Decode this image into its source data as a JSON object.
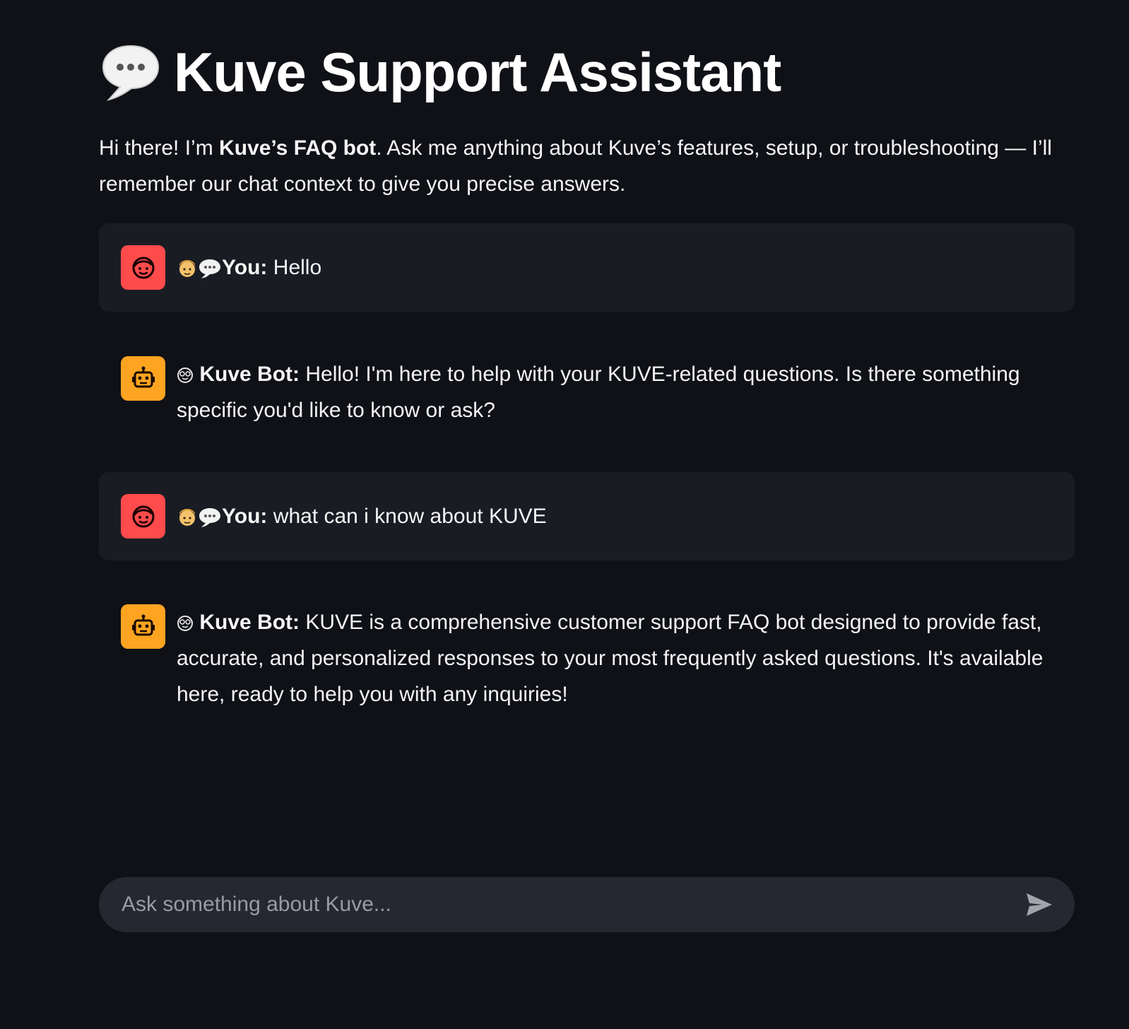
{
  "header": {
    "title": "Kuve Support Assistant",
    "title_icon": "speech-balloon-icon"
  },
  "intro": {
    "prefix": "Hi there! I’m ",
    "bold": "Kuve’s FAQ bot",
    "suffix": ". Ask me anything about Kuve’s features, setup, or troubleshooting — I’ll remember our chat context to give you precise answers."
  },
  "messages": [
    {
      "role": "user",
      "avatar_icon": "user-face-icon",
      "prefix_icons": [
        "person-emoji-icon",
        "speech-balloon-icon"
      ],
      "speaker": "You:",
      "text": " Hello"
    },
    {
      "role": "assistant",
      "avatar_icon": "robot-face-icon",
      "prefix_icons": [
        "nerd-face-emoji-icon"
      ],
      "speaker": "Kuve Bot:",
      "text": " Hello! I'm here to help with your KUVE-related questions. Is there something specific you'd like to know or ask?"
    },
    {
      "role": "user",
      "avatar_icon": "user-face-icon",
      "prefix_icons": [
        "person-emoji-icon",
        "speech-balloon-icon"
      ],
      "speaker": "You:",
      "text": " what can i know about KUVE"
    },
    {
      "role": "assistant",
      "avatar_icon": "robot-face-icon",
      "prefix_icons": [
        "nerd-face-emoji-icon"
      ],
      "speaker": "Kuve Bot:",
      "text": " KUVE is a comprehensive customer support FAQ bot designed to provide fast, accurate, and personalized responses to your most frequently asked questions. It's available here, ready to help you with any inquiries!"
    }
  ],
  "chat_input": {
    "placeholder": "Ask something about Kuve...",
    "value": "",
    "send_icon": "send-arrow-icon"
  },
  "colors": {
    "background": "#0f1117",
    "user_bubble": "#1a1c24",
    "user_avatar": "#ff4b4b",
    "bot_avatar": "#ffa421",
    "input_bg": "#262730"
  }
}
